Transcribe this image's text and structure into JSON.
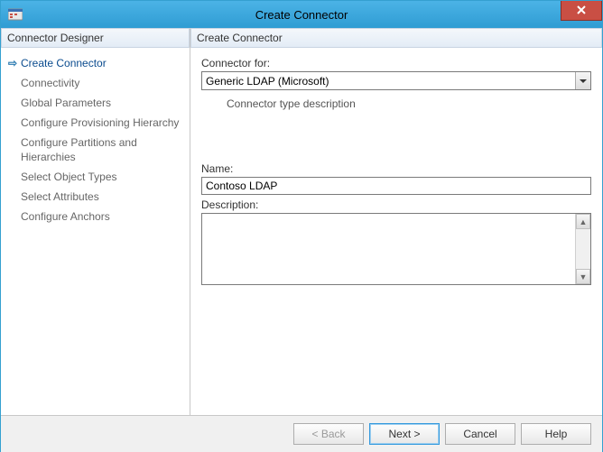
{
  "window": {
    "title": "Create Connector"
  },
  "sidebar": {
    "header": "Connector Designer",
    "items": [
      {
        "label": "Create Connector",
        "current": true
      },
      {
        "label": "Connectivity",
        "current": false
      },
      {
        "label": "Global Parameters",
        "current": false
      },
      {
        "label": "Configure Provisioning Hierarchy",
        "current": false
      },
      {
        "label": "Configure Partitions and Hierarchies",
        "current": false
      },
      {
        "label": "Select Object Types",
        "current": false
      },
      {
        "label": "Select Attributes",
        "current": false
      },
      {
        "label": "Configure Anchors",
        "current": false
      }
    ]
  },
  "main": {
    "header": "Create Connector",
    "connector_for_label": "Connector for:",
    "connector_for_value": "Generic LDAP (Microsoft)",
    "type_description": "Connector type description",
    "name_label": "Name:",
    "name_value": "Contoso LDAP",
    "description_label": "Description:",
    "description_value": ""
  },
  "footer": {
    "back": "<  Back",
    "next": "Next  >",
    "cancel": "Cancel",
    "help": "Help"
  }
}
